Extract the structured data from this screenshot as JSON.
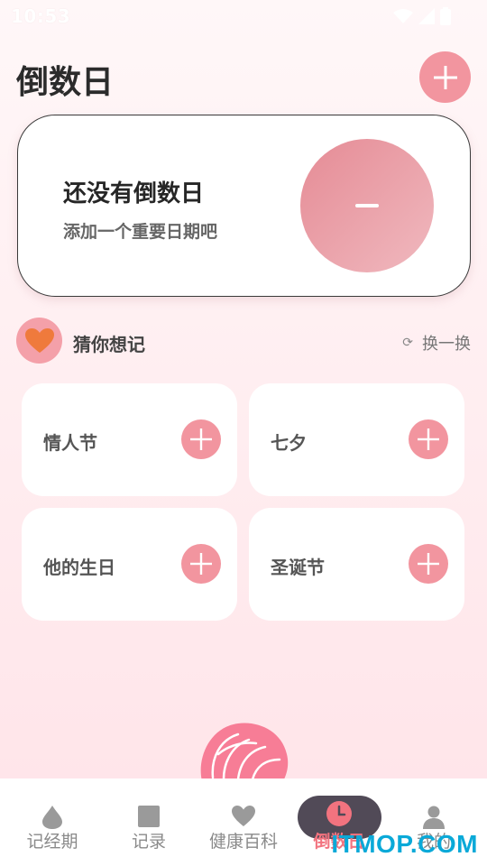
{
  "status_bar": {
    "time": "10:53"
  },
  "header": {
    "title": "倒数日"
  },
  "empty_state": {
    "title": "还没有倒数日",
    "subtitle": "添加一个重要日期吧"
  },
  "guess": {
    "title": "猜你想记",
    "refresh_label": "换一换",
    "refresh_icon": "refresh-icon"
  },
  "suggestions": [
    {
      "label": "情人节"
    },
    {
      "label": "七夕"
    },
    {
      "label": "他的生日"
    },
    {
      "label": "圣诞节"
    }
  ],
  "bottom_nav": {
    "items": [
      {
        "label": "记经期",
        "icon": "drop-icon"
      },
      {
        "label": "记录",
        "icon": "square-icon"
      },
      {
        "label": "健康百科",
        "icon": "heart-icon"
      },
      {
        "label": "倒数日",
        "icon": "clock-icon",
        "active": true
      },
      {
        "label": "我的",
        "icon": "person-icon"
      }
    ]
  },
  "watermark": "ITMOP.COM",
  "colors": {
    "accent": "#f2959f",
    "active_nav": "#f2737f",
    "nav_pill": "#514a57",
    "background_top": "#fff7f8"
  }
}
